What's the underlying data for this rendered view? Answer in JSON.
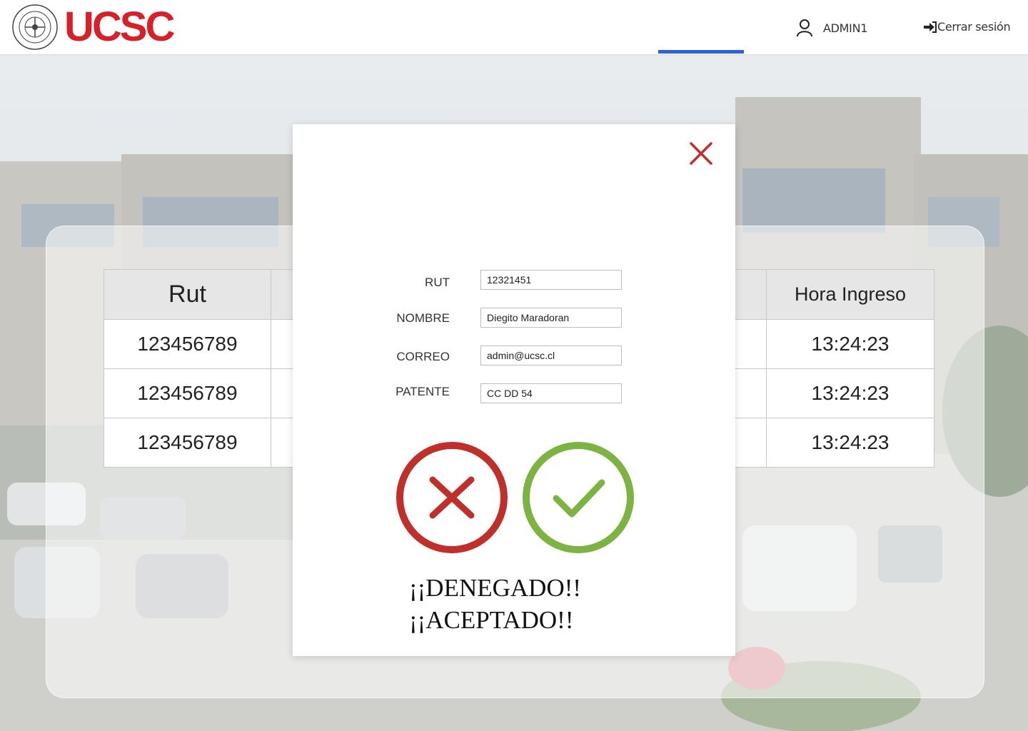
{
  "header": {
    "brand": "UCSC",
    "user_name": "ADMIN1",
    "logout_label": "Cerrar sesión"
  },
  "colors": {
    "brand_red": "#d6212b",
    "accent_blue": "#2e62d6",
    "deny_red": "#c0302b",
    "accept_green": "#7cb342"
  },
  "table": {
    "columns": [
      "Rut",
      "Hora Ingreso"
    ],
    "rows": [
      {
        "rut": "123456789",
        "hora": "13:24:23"
      },
      {
        "rut": "123456789",
        "hora": "13:24:23"
      },
      {
        "rut": "123456789",
        "hora": "13:24:23"
      }
    ]
  },
  "modal": {
    "fields": [
      {
        "label": "RUT",
        "value": "12321451"
      },
      {
        "label": "NOMBRE",
        "value": "Diegito Maradoran"
      },
      {
        "label": "CORREO",
        "value": "admin@ucsc.cl"
      },
      {
        "label": "PATENTE",
        "value": "CC DD 54"
      }
    ],
    "denied_text": "¡¡DENEGADO!!",
    "accepted_text": "¡¡ACEPTADO!!",
    "icons": {
      "close": "close-icon",
      "deny": "deny-x-icon",
      "accept": "accept-check-icon"
    }
  }
}
